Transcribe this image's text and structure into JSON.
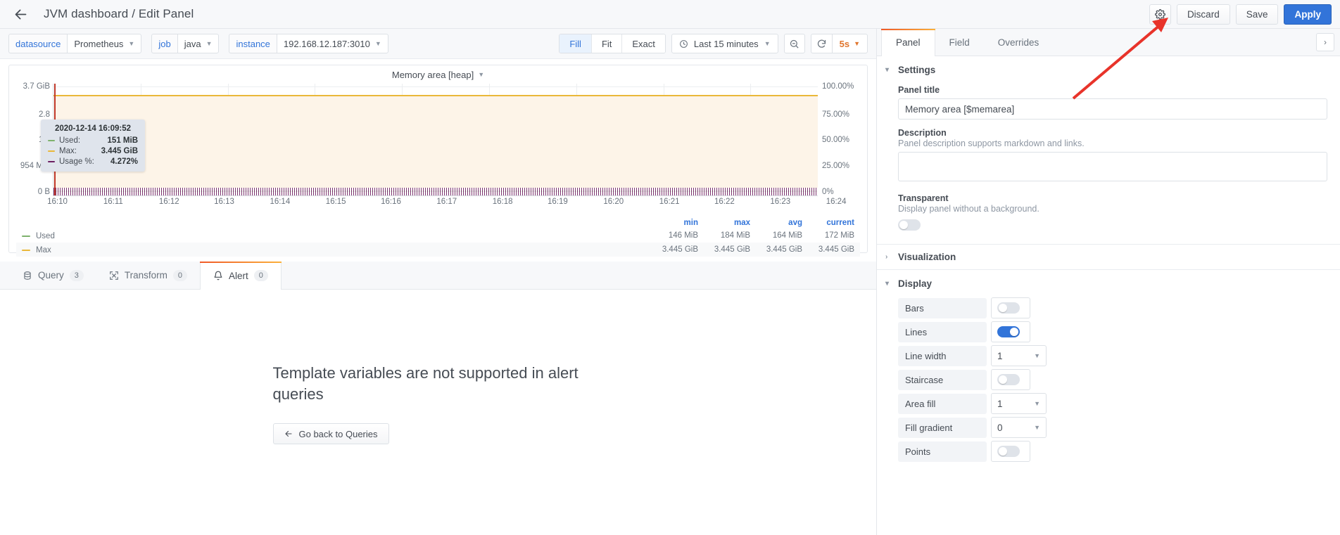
{
  "header": {
    "back_icon": "arrow-left-icon",
    "title": "JVM dashboard / Edit Panel",
    "settings_icon": "gear-icon",
    "discard_label": "Discard",
    "save_label": "Save",
    "apply_label": "Apply"
  },
  "toolbar": {
    "variables": [
      {
        "label": "datasource",
        "value": "Prometheus"
      },
      {
        "label": "job",
        "value": "java"
      },
      {
        "label": "instance",
        "value": "192.168.12.187:3010"
      }
    ],
    "fit_modes": [
      {
        "label": "Fill",
        "active": true
      },
      {
        "label": "Fit",
        "active": false
      },
      {
        "label": "Exact",
        "active": false
      }
    ],
    "time_range": "Last 15 minutes",
    "time_icon": "clock-icon",
    "zoom_out_icon": "zoom-out-icon",
    "refresh_icon": "refresh-icon",
    "refresh_interval": "5s"
  },
  "panel": {
    "title": "Memory area [heap]",
    "menu_icon": "chevron-down-icon"
  },
  "chart_data": {
    "type": "line",
    "title": "Memory area [heap]",
    "xlabel": "",
    "ylabel": "",
    "grid": true,
    "legend_position": "bottom-table",
    "y_left_ticks": [
      "3.7 GiB",
      "2.8",
      "1.9",
      "954 MiB",
      "0 B"
    ],
    "y_right_ticks": [
      "100.00%",
      "75.00%",
      "50.00%",
      "25.00%",
      "0%"
    ],
    "y_left_range": [
      "0 B",
      "3.7 GiB"
    ],
    "y_right_range": [
      "0%",
      "100.00%"
    ],
    "x_ticks": [
      "16:10",
      "16:11",
      "16:12",
      "16:13",
      "16:14",
      "16:15",
      "16:16",
      "16:17",
      "16:18",
      "16:19",
      "16:20",
      "16:21",
      "16:22",
      "16:23",
      "16:24"
    ],
    "series": [
      {
        "name": "Used",
        "color": "#7eb26d",
        "axis": "left",
        "approx_value": "164 MiB"
      },
      {
        "name": "Max",
        "color": "#eab839",
        "axis": "left",
        "approx_value": "3.445 GiB"
      },
      {
        "name": "Usage %",
        "color": "#6d1f62",
        "axis": "right",
        "approx_value": "4.272%"
      }
    ],
    "legend_columns": [
      "min",
      "max",
      "avg",
      "current"
    ],
    "legend_rows": [
      {
        "name": "Used",
        "color": "#7eb26d",
        "min": "146 MiB",
        "max": "184 MiB",
        "avg": "164 MiB",
        "current": "172 MiB"
      },
      {
        "name": "Max",
        "color": "#eab839",
        "min": "3.445 GiB",
        "max": "3.445 GiB",
        "avg": "3.445 GiB",
        "current": "3.445 GiB"
      }
    ]
  },
  "tooltip": {
    "time": "2020-12-14 16:09:52",
    "rows": [
      {
        "label": "Used:",
        "value": "151 MiB",
        "color": "#7eb26d"
      },
      {
        "label": "Max:",
        "value": "3.445 GiB",
        "color": "#eab839"
      },
      {
        "label": "Usage %:",
        "value": "4.272%",
        "color": "#6d1f62"
      }
    ]
  },
  "tabs": [
    {
      "label": "Query",
      "badge": "3",
      "icon": "database-icon",
      "active": false
    },
    {
      "label": "Transform",
      "badge": "0",
      "icon": "transform-icon",
      "active": false
    },
    {
      "label": "Alert",
      "badge": "0",
      "icon": "bell-icon",
      "active": true
    }
  ],
  "empty_state": {
    "title": "Template variables are not supported in alert queries",
    "button_label": "Go back to Queries",
    "button_icon": "arrow-left-icon"
  },
  "options": {
    "tabs": [
      {
        "label": "Panel",
        "active": true
      },
      {
        "label": "Field",
        "active": false
      },
      {
        "label": "Overrides",
        "active": false
      }
    ],
    "collapse_icon": "chevron-right-icon",
    "settings": {
      "heading": "Settings",
      "expanded": true,
      "panel_title_label": "Panel title",
      "panel_title_value": "Memory area [$memarea]",
      "description_label": "Description",
      "description_help": "Panel description supports markdown and links.",
      "description_value": "",
      "transparent_label": "Transparent",
      "transparent_desc": "Display panel without a background.",
      "transparent_on": false
    },
    "visualization": {
      "heading": "Visualization",
      "expanded": false
    },
    "display": {
      "heading": "Display",
      "expanded": true,
      "rows": [
        {
          "name": "Bars",
          "control": "toggle",
          "value": "off"
        },
        {
          "name": "Lines",
          "control": "toggle",
          "value": "on"
        },
        {
          "name": "Line width",
          "control": "select",
          "value": "1"
        },
        {
          "name": "Staircase",
          "control": "toggle",
          "value": "off"
        },
        {
          "name": "Area fill",
          "control": "select",
          "value": "1"
        },
        {
          "name": "Fill gradient",
          "control": "select",
          "value": "0"
        },
        {
          "name": "Points",
          "control": "toggle",
          "value": "off"
        }
      ]
    }
  },
  "colors": {
    "accent": "#3274d9",
    "used": "#7eb26d",
    "max": "#eab839",
    "usage": "#6d1f62",
    "annotation": "#e8332a"
  }
}
